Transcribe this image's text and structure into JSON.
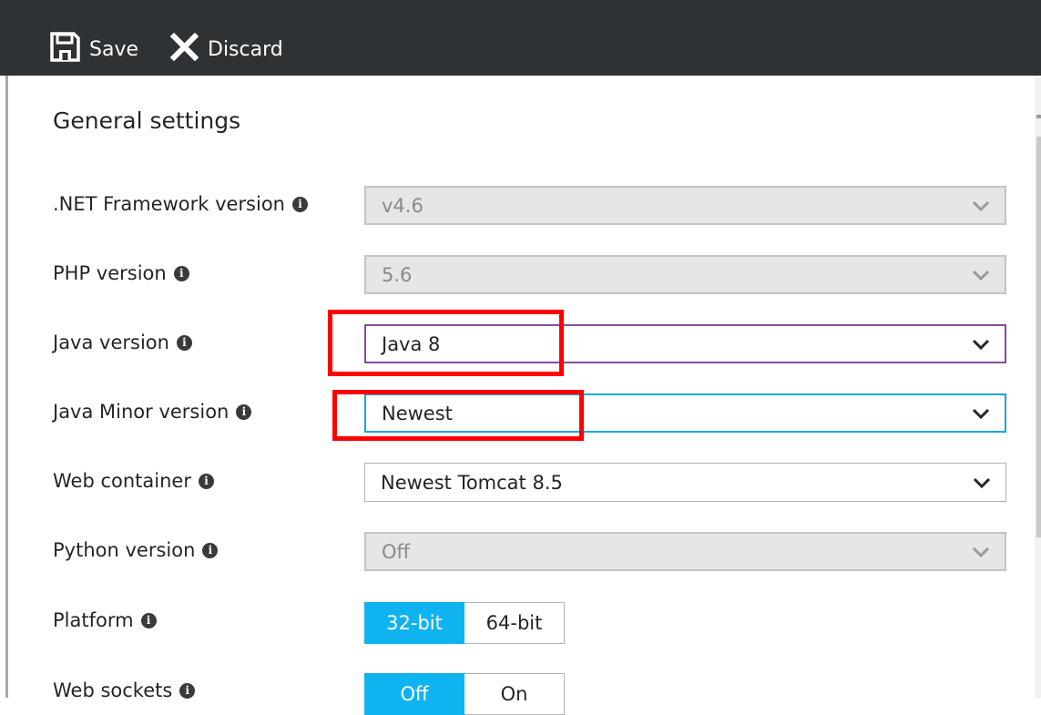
{
  "toolbar": {
    "save_label": "Save",
    "discard_label": "Discard",
    "background": "#2f3235"
  },
  "section": {
    "title": "General settings"
  },
  "settings": [
    {
      "label": ".NET Framework version",
      "value": "v4.6",
      "disabled": true
    },
    {
      "label": "PHP version",
      "value": "5.6",
      "disabled": true
    },
    {
      "label": "Java version",
      "value": "Java 8",
      "disabled": false
    },
    {
      "label": "Java Minor version",
      "value": "Newest",
      "disabled": false
    },
    {
      "label": "Web container",
      "value": "Newest Tomcat 8.5",
      "disabled": false
    },
    {
      "label": "Python version",
      "value": "Off",
      "disabled": true
    }
  ],
  "platform": {
    "label": "Platform",
    "options": [
      "32-bit",
      "64-bit"
    ],
    "selected": "32-bit"
  },
  "web_sockets": {
    "label": "Web sockets",
    "options": [
      "Off",
      "On"
    ],
    "selected": "Off"
  },
  "colors": {
    "accent": "#0fb3ef",
    "highlight": "#ff0000",
    "focus_purple": "#8a4a9a",
    "focus_blue": "#1aa7d8"
  },
  "icons": {
    "save": "floppy-disk-icon",
    "discard": "close-x-icon",
    "info": "info-icon",
    "dropdown": "chevron-down-icon"
  }
}
